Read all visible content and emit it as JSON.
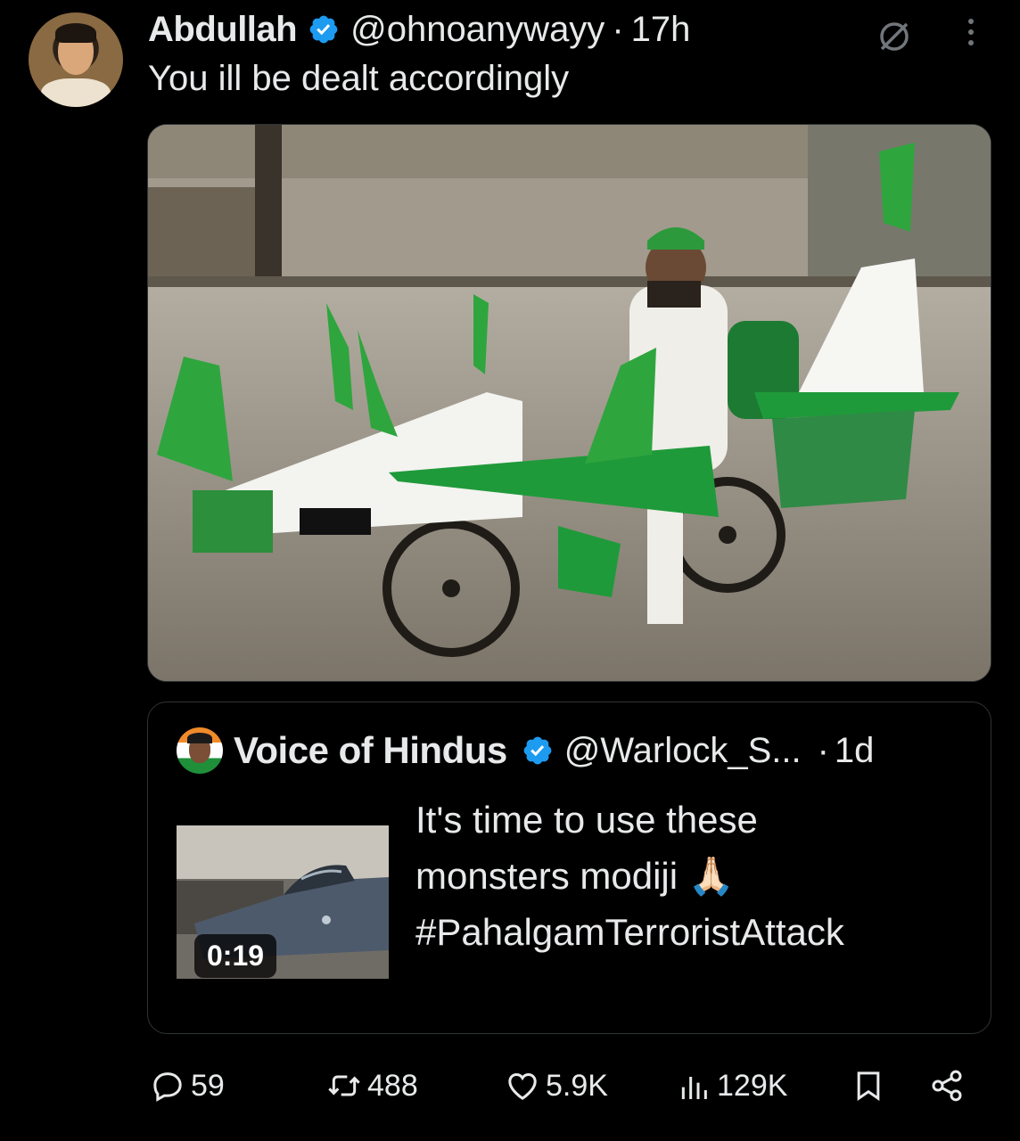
{
  "author": {
    "display_name": "Abdullah",
    "handle": "@ohnoanywayy",
    "separator": "·",
    "time": "17h",
    "text": "You ill be dealt accordingly"
  },
  "colors": {
    "background": "#000000",
    "text": "#e7e9ea",
    "verified_blue": "#1d9bf0",
    "border": "#2f3336"
  },
  "media": {
    "icon": "photo-motorcycle-airplane"
  },
  "quote": {
    "display_name": "Voice of Hindus",
    "handle": "@Warlock_S...",
    "separator": "·",
    "time": "1d",
    "video_duration": "0:19",
    "text_lines": [
      "It's time to use these",
      "monsters modiji 🙏🏻",
      "#PahalgamTerroristAttack"
    ]
  },
  "actions": {
    "replies": "59",
    "retweets": "488",
    "likes": "5.9K",
    "views": "129K"
  }
}
